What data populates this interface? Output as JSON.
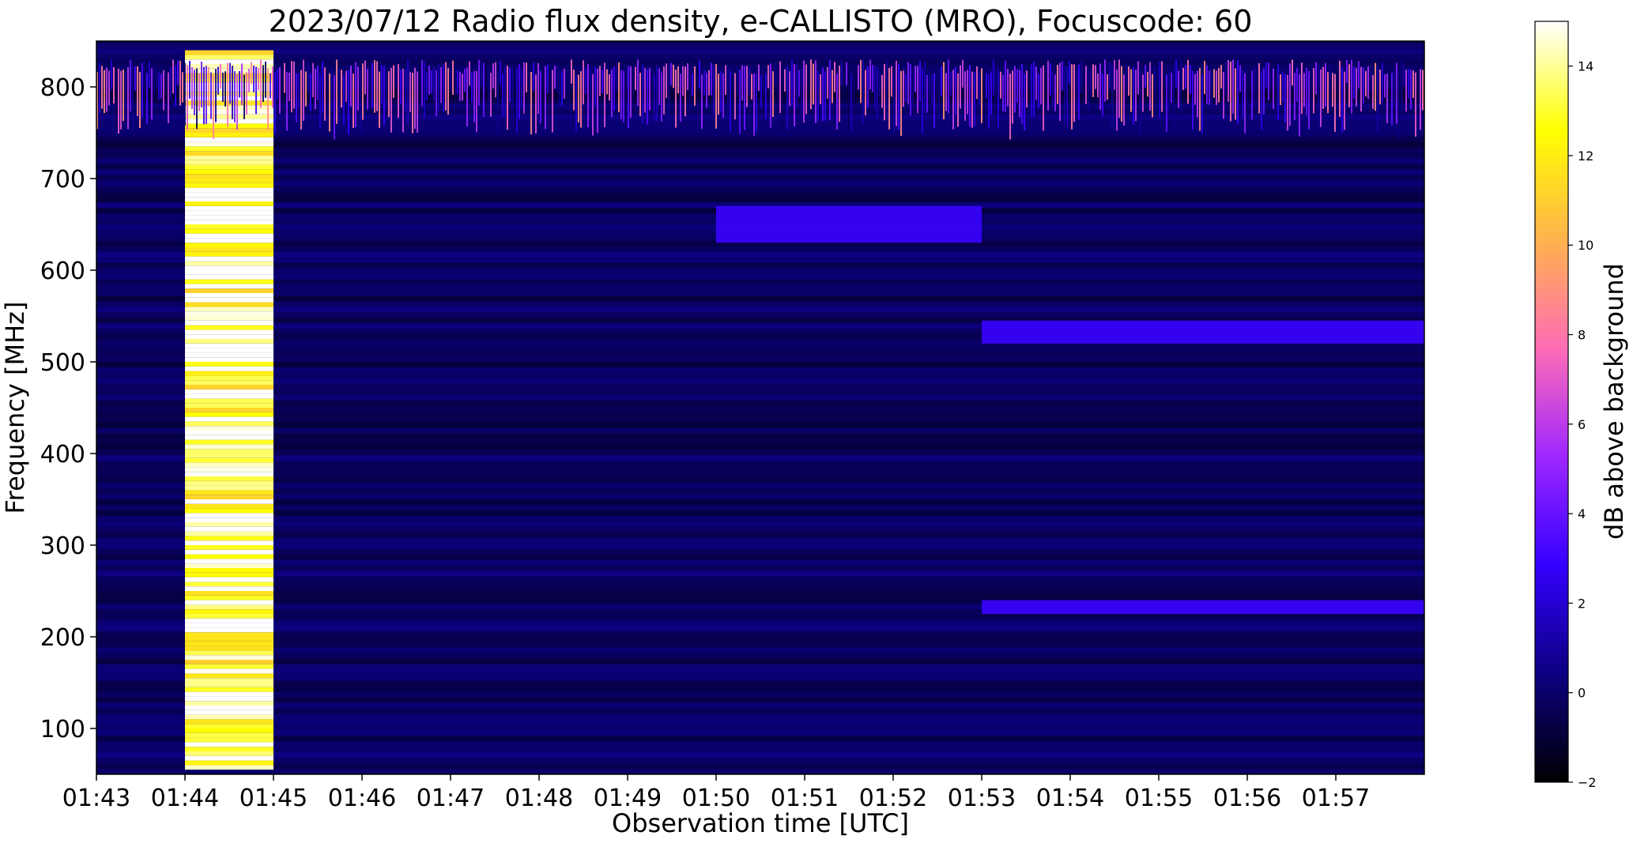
{
  "chart_data": {
    "type": "heatmap",
    "title": "2023/07/12  Radio flux density, e-CALLISTO (MRO), Focuscode: 60",
    "xlabel": "Observation time [UTC]",
    "ylabel": "Frequency [MHz]",
    "x_ticks": [
      "01:43",
      "01:44",
      "01:45",
      "01:46",
      "01:47",
      "01:48",
      "01:49",
      "01:50",
      "01:51",
      "01:52",
      "01:53",
      "01:54",
      "01:55",
      "01:56",
      "01:57"
    ],
    "y_ticks": [
      100,
      200,
      300,
      400,
      500,
      600,
      700,
      800
    ],
    "x_range_minutes": [
      0,
      15.0
    ],
    "ylim": [
      50,
      850
    ],
    "colorbar": {
      "label": "dB above background",
      "min": -2,
      "max": 15,
      "ticks": [
        -2,
        0,
        2,
        4,
        6,
        8,
        10,
        12,
        14
      ],
      "colormap": "gnuplot2",
      "colors": [
        "#000000",
        "#0c0080",
        "#3400ff",
        "#9f27ff",
        "#ff6db5",
        "#ffb34c",
        "#ffff00",
        "#ffffff"
      ]
    },
    "regions": [
      {
        "x_start": "01:44",
        "x_end": "01:45",
        "f_min": 55,
        "f_max": 840,
        "level_db": 14,
        "note": "broadband saturated interval"
      },
      {
        "x_start": "01:43",
        "x_end": "01:58",
        "f_min": 750,
        "f_max": 830,
        "level_db": 6,
        "note": "intermittent bursts"
      },
      {
        "x_start": "01:50",
        "x_end": "01:53",
        "f_min": 630,
        "f_max": 670,
        "level_db": 3,
        "note": "enhanced band"
      },
      {
        "x_start": "01:53",
        "x_end": "01:58",
        "f_min": 520,
        "f_max": 545,
        "level_db": 3,
        "note": "enhanced band"
      },
      {
        "x_start": "01:53",
        "x_end": "01:58",
        "f_min": 225,
        "f_max": 240,
        "level_db": 3,
        "note": "enhanced band"
      }
    ]
  }
}
